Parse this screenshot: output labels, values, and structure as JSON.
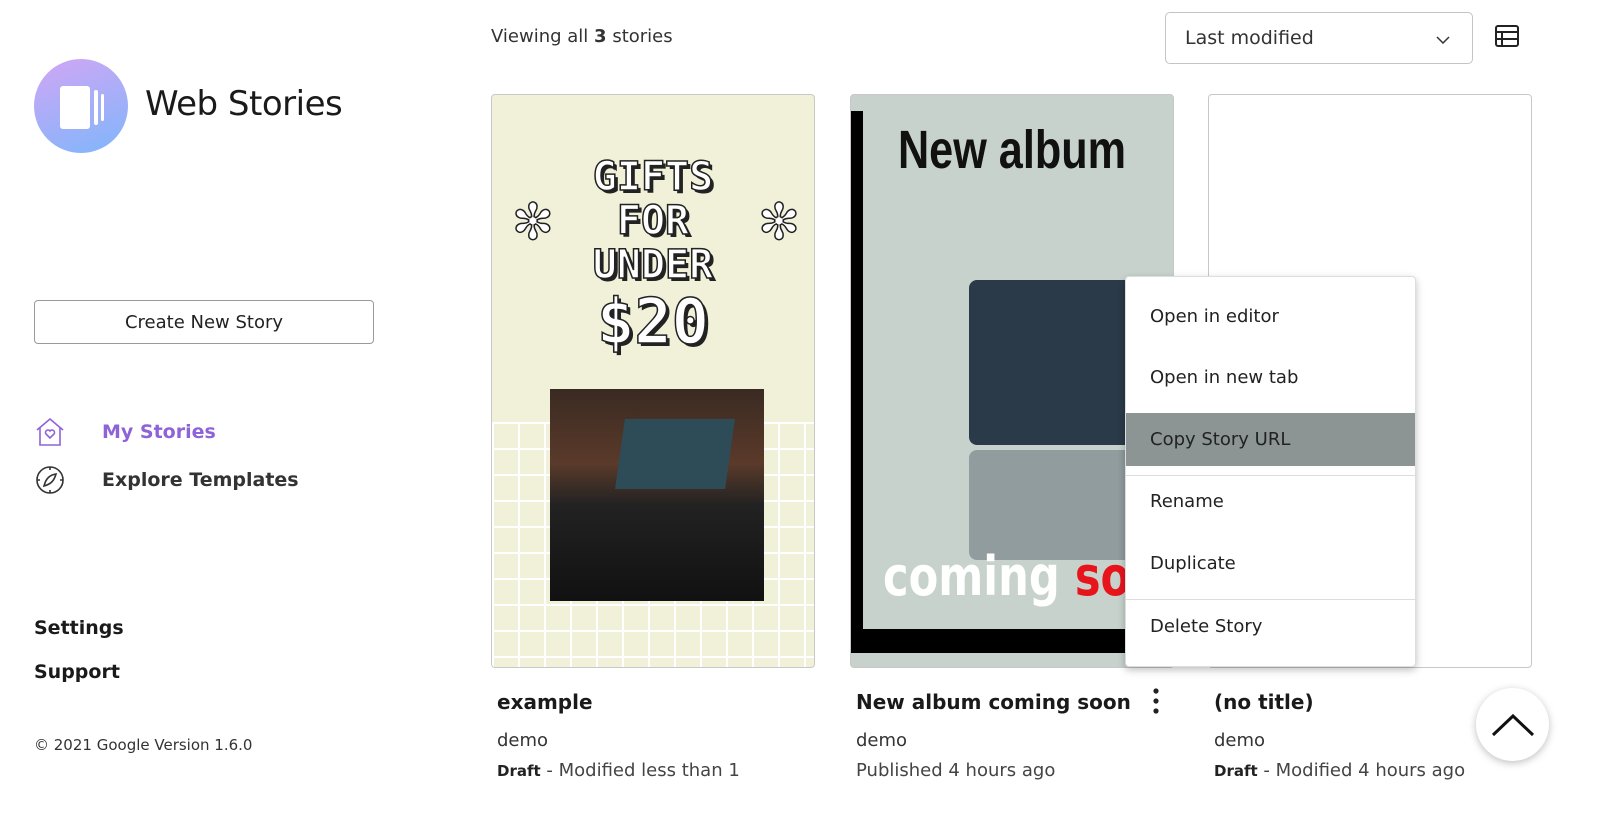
{
  "brand": {
    "name": "Web Stories",
    "logo_colors": [
      "#d1a6f5",
      "#7fb6fb"
    ]
  },
  "sidebar": {
    "create_label": "Create New Story",
    "nav": [
      {
        "label": "My Stories",
        "icon": "home-heart-icon",
        "active": true,
        "color": "#8f63d8"
      },
      {
        "label": "Explore Templates",
        "icon": "compass-icon",
        "active": false
      }
    ],
    "settings": "Settings",
    "support": "Support",
    "footer": "© 2021 Google Version 1.6.0"
  },
  "header": {
    "viewing_prefix": "Viewing all",
    "count": "3",
    "viewing_suffix": "stories",
    "sort_value": "Last modified",
    "view_icon": "list-view-icon"
  },
  "stories": [
    {
      "title": "example",
      "author": "demo",
      "status": "Draft",
      "modified": " - Modified less than 1",
      "poster_text": [
        "GIFTS",
        "FOR",
        "UNDER",
        "$20"
      ]
    },
    {
      "title": "New album coming soon",
      "author": "demo",
      "status_text": "Published 4 hours ago",
      "poster_text": [
        "New album",
        "coming",
        "soon"
      ]
    },
    {
      "title": "(no title)",
      "author": "demo",
      "status": "Draft",
      "modified": " - Modified 4 hours ago"
    }
  ],
  "context_menu": {
    "items": [
      "Open in editor",
      "Open in new tab",
      "Copy Story URL",
      "Rename",
      "Duplicate",
      "Delete Story"
    ],
    "highlighted": "Copy Story URL"
  }
}
